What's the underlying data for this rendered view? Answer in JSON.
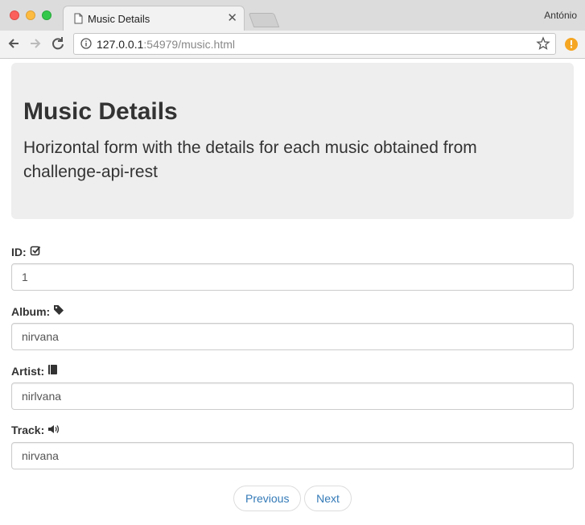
{
  "browser": {
    "tab_title": "Music Details",
    "tab_close": "✕",
    "profile_name": "António",
    "url_host": "127.0.0.1",
    "url_rest": ":54979/music.html"
  },
  "jumbotron": {
    "title": "Music Details",
    "subtitle": "Horizontal form with the details for each music obtained from challenge-api-rest"
  },
  "form": {
    "fields": [
      {
        "label": "ID:",
        "icon": "check-square-icon",
        "value": "1"
      },
      {
        "label": "Album:",
        "icon": "tag-icon",
        "value": "nirvana"
      },
      {
        "label": "Artist:",
        "icon": "book-icon",
        "value": "nirlvana"
      },
      {
        "label": "Track:",
        "icon": "volume-icon",
        "value": "nirvana"
      }
    ]
  },
  "pager": {
    "previous_label": "Previous",
    "next_label": "Next"
  },
  "colors": {
    "accent": "#337ab7",
    "jumbotron_bg": "#eeeeee"
  }
}
